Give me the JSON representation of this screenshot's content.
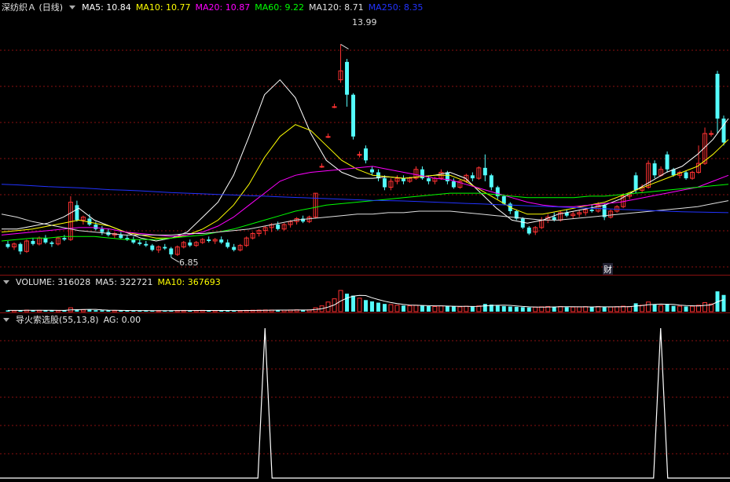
{
  "price_panel": {
    "title": "深纺织Ａ (日线)",
    "ma": [
      {
        "label": "MA5: 10.84",
        "color": "#ffffff"
      },
      {
        "label": "MA10: 10.77",
        "color": "#ffff00"
      },
      {
        "label": "MA20: 10.87",
        "color": "#ff00ff"
      },
      {
        "label": "MA60: 9.22",
        "color": "#00ff00"
      },
      {
        "label": "MA120: 8.71",
        "color": "#e0e0e0"
      },
      {
        "label": "MA250: 8.35",
        "color": "#2233ff"
      }
    ],
    "high_label": "13.99",
    "low_label": "6.85",
    "marker_label": "财"
  },
  "volume_panel": {
    "title": "VOLUME: 316028",
    "ma5": "MA5: 322721",
    "ma10": "MA10: 367693"
  },
  "indicator_panel": {
    "title": "导火索选股(55,13,8)",
    "value": "AG: 0.00"
  },
  "colors": {
    "up": "#ff3232",
    "down": "#54fcfc",
    "grid": "#8a1010",
    "ag": "#ffffff"
  },
  "chart_data": [
    {
      "type": "candlestick",
      "ylim": [
        6.4,
        15
      ],
      "candles": [
        [
          7.3,
          7.4,
          7.15,
          7.2
        ],
        [
          7.2,
          7.35,
          7.1,
          7.3
        ],
        [
          7.3,
          7.35,
          6.95,
          7.05
        ],
        [
          7.05,
          7.45,
          7.0,
          7.4
        ],
        [
          7.4,
          7.5,
          7.25,
          7.3
        ],
        [
          7.3,
          7.55,
          7.25,
          7.5
        ],
        [
          7.5,
          7.6,
          7.3,
          7.35
        ],
        [
          7.35,
          7.4,
          7.2,
          7.3
        ],
        [
          7.3,
          7.55,
          7.25,
          7.5
        ],
        [
          7.5,
          7.6,
          7.4,
          7.45
        ],
        [
          7.45,
          8.9,
          7.4,
          8.7
        ],
        [
          8.6,
          8.75,
          8.05,
          8.1
        ],
        [
          8.1,
          8.25,
          7.95,
          8.2
        ],
        [
          8.15,
          8.3,
          7.9,
          7.95
        ],
        [
          7.95,
          8.05,
          7.75,
          7.8
        ],
        [
          7.8,
          7.9,
          7.6,
          7.7
        ],
        [
          7.7,
          7.8,
          7.55,
          7.6
        ],
        [
          7.6,
          7.7,
          7.5,
          7.65
        ],
        [
          7.6,
          7.7,
          7.45,
          7.5
        ],
        [
          7.5,
          7.6,
          7.4,
          7.45
        ],
        [
          7.45,
          7.55,
          7.3,
          7.35
        ],
        [
          7.35,
          7.45,
          7.25,
          7.3
        ],
        [
          7.3,
          7.4,
          7.2,
          7.25
        ],
        [
          7.25,
          7.3,
          7.05,
          7.1
        ],
        [
          7.1,
          7.25,
          7.0,
          7.2
        ],
        [
          7.2,
          7.3,
          7.1,
          7.15
        ],
        [
          7.15,
          7.2,
          6.85,
          6.95
        ],
        [
          6.95,
          7.25,
          6.9,
          7.2
        ],
        [
          7.2,
          7.4,
          7.15,
          7.35
        ],
        [
          7.35,
          7.45,
          7.2,
          7.25
        ],
        [
          7.25,
          7.4,
          7.2,
          7.35
        ],
        [
          7.35,
          7.5,
          7.3,
          7.45
        ],
        [
          7.45,
          7.55,
          7.35,
          7.4
        ],
        [
          7.4,
          7.5,
          7.3,
          7.45
        ],
        [
          7.45,
          7.55,
          7.3,
          7.35
        ],
        [
          7.35,
          7.45,
          7.15,
          7.2
        ],
        [
          7.2,
          7.3,
          7.05,
          7.1
        ],
        [
          7.1,
          7.3,
          7.05,
          7.25
        ],
        [
          7.25,
          7.55,
          7.2,
          7.5
        ],
        [
          7.5,
          7.7,
          7.45,
          7.65
        ],
        [
          7.65,
          7.8,
          7.55,
          7.75
        ],
        [
          7.75,
          7.9,
          7.6,
          7.85
        ],
        [
          7.85,
          8.0,
          7.7,
          7.95
        ],
        [
          7.95,
          8.05,
          7.75,
          7.8
        ],
        [
          7.8,
          8.0,
          7.75,
          7.95
        ],
        [
          7.95,
          8.1,
          7.85,
          8.05
        ],
        [
          8.05,
          8.2,
          7.95,
          8.15
        ],
        [
          8.15,
          8.25,
          8.0,
          8.05
        ],
        [
          8.05,
          8.25,
          8.0,
          8.2
        ],
        [
          8.2,
          9.0,
          8.15,
          9.0
        ],
        [
          9.9,
          10.0,
          9.85,
          9.9
        ],
        [
          10.9,
          11.0,
          10.85,
          10.9
        ],
        [
          11.9,
          12.0,
          11.85,
          11.9
        ],
        [
          12.8,
          13.99,
          12.7,
          13.1
        ],
        [
          13.4,
          13.5,
          11.9,
          12.3
        ],
        [
          12.3,
          12.35,
          10.8,
          10.9
        ],
        [
          10.3,
          10.4,
          10.2,
          10.3
        ],
        [
          10.5,
          10.6,
          10.0,
          10.1
        ],
        [
          9.8,
          9.9,
          9.6,
          9.7
        ],
        [
          9.7,
          9.8,
          9.4,
          9.5
        ],
        [
          9.5,
          9.6,
          9.1,
          9.2
        ],
        [
          9.2,
          9.5,
          9.1,
          9.4
        ],
        [
          9.4,
          9.6,
          9.3,
          9.5
        ],
        [
          9.5,
          9.6,
          9.3,
          9.4
        ],
        [
          9.4,
          9.55,
          9.35,
          9.5
        ],
        [
          9.5,
          9.9,
          9.45,
          9.8
        ],
        [
          9.8,
          9.9,
          9.45,
          9.5
        ],
        [
          9.5,
          9.6,
          9.3,
          9.4
        ],
        [
          9.4,
          9.55,
          9.3,
          9.5
        ],
        [
          9.5,
          9.8,
          9.45,
          9.7
        ],
        [
          9.7,
          9.75,
          9.3,
          9.4
        ],
        [
          9.4,
          9.5,
          9.15,
          9.2
        ],
        [
          9.2,
          9.45,
          9.15,
          9.4
        ],
        [
          9.4,
          9.65,
          9.35,
          9.6
        ],
        [
          9.6,
          9.7,
          9.4,
          9.5
        ],
        [
          9.5,
          9.9,
          9.45,
          9.85
        ],
        [
          9.85,
          10.3,
          9.4,
          9.6
        ],
        [
          9.6,
          9.65,
          9.1,
          9.2
        ],
        [
          9.2,
          9.25,
          8.8,
          8.9
        ],
        [
          8.9,
          8.95,
          8.6,
          8.65
        ],
        [
          8.65,
          8.7,
          8.3,
          8.4
        ],
        [
          8.4,
          8.45,
          8.1,
          8.15
        ],
        [
          8.15,
          8.2,
          7.8,
          7.85
        ],
        [
          7.85,
          7.9,
          7.6,
          7.65
        ],
        [
          7.7,
          7.9,
          7.6,
          7.85
        ],
        [
          7.85,
          8.2,
          7.8,
          8.1
        ],
        [
          8.1,
          8.3,
          8.0,
          8.2
        ],
        [
          8.2,
          8.35,
          8.05,
          8.1
        ],
        [
          8.1,
          8.4,
          8.05,
          8.35
        ],
        [
          8.35,
          8.45,
          8.2,
          8.25
        ],
        [
          8.25,
          8.4,
          8.15,
          8.3
        ],
        [
          8.3,
          8.45,
          8.2,
          8.35
        ],
        [
          8.35,
          8.5,
          8.25,
          8.45
        ],
        [
          8.45,
          8.6,
          8.35,
          8.4
        ],
        [
          8.4,
          8.7,
          8.35,
          8.6
        ],
        [
          8.6,
          8.65,
          8.1,
          8.2
        ],
        [
          8.2,
          8.45,
          8.15,
          8.4
        ],
        [
          8.4,
          8.6,
          8.35,
          8.55
        ],
        [
          8.55,
          9.0,
          8.5,
          8.9
        ],
        [
          8.9,
          9.0,
          8.8,
          8.95
        ],
        [
          9.6,
          9.7,
          9.0,
          9.1
        ],
        [
          9.1,
          9.3,
          9.0,
          9.2
        ],
        [
          9.2,
          10.1,
          9.15,
          10.0
        ],
        [
          10.0,
          10.1,
          9.5,
          9.6
        ],
        [
          9.6,
          9.9,
          9.55,
          9.8
        ],
        [
          10.3,
          10.4,
          9.7,
          9.8
        ],
        [
          9.8,
          9.85,
          9.55,
          9.6
        ],
        [
          9.6,
          9.75,
          9.5,
          9.7
        ],
        [
          9.7,
          9.75,
          9.45,
          9.5
        ],
        [
          9.5,
          9.75,
          9.45,
          9.7
        ],
        [
          9.7,
          10.6,
          9.65,
          10.0
        ],
        [
          10.0,
          11.2,
          9.95,
          11.0
        ],
        [
          11.0,
          11.1,
          10.9,
          11.0
        ],
        [
          13.0,
          13.1,
          11.0,
          11.5
        ],
        [
          11.5,
          11.6,
          10.6,
          10.7
        ]
      ],
      "ma": {
        "MA5": [
          7.8,
          7.8,
          7.9,
          8.0,
          8.2,
          8.5,
          8.1,
          7.9,
          7.7,
          7.5,
          7.4,
          7.5,
          7.7,
          8.2,
          8.7,
          9.6,
          10.9,
          12.3,
          12.8,
          12.2,
          11.0,
          10.1,
          9.7,
          9.5,
          9.5,
          9.55,
          9.5,
          9.55,
          9.6,
          9.7,
          9.5,
          9.0,
          8.5,
          8.1,
          8.0,
          8.1,
          8.3,
          8.4,
          8.5,
          8.6,
          8.8,
          9.1,
          9.4,
          9.7,
          9.9,
          10.3,
          10.8,
          11.5
        ],
        "MA10": [
          7.7,
          7.75,
          7.8,
          7.9,
          8.0,
          8.1,
          8.0,
          7.9,
          7.7,
          7.6,
          7.5,
          7.5,
          7.6,
          7.8,
          8.1,
          8.6,
          9.3,
          10.2,
          10.9,
          11.3,
          11.1,
          10.6,
          10.1,
          9.8,
          9.6,
          9.55,
          9.5,
          9.55,
          9.6,
          9.6,
          9.4,
          9.1,
          8.8,
          8.5,
          8.3,
          8.3,
          8.4,
          8.5,
          8.6,
          8.7,
          8.9,
          9.1,
          9.3,
          9.5,
          9.7,
          9.9,
          10.3,
          10.8
        ],
        "MA20": [
          7.6,
          7.65,
          7.7,
          7.75,
          7.8,
          7.85,
          7.85,
          7.8,
          7.7,
          7.65,
          7.6,
          7.55,
          7.6,
          7.7,
          7.9,
          8.2,
          8.6,
          9.0,
          9.4,
          9.6,
          9.7,
          9.75,
          9.8,
          9.85,
          9.9,
          9.8,
          9.7,
          9.6,
          9.5,
          9.45,
          9.3,
          9.15,
          9.0,
          8.85,
          8.7,
          8.6,
          8.55,
          8.55,
          8.6,
          8.65,
          8.7,
          8.8,
          8.9,
          9.0,
          9.1,
          9.2,
          9.4,
          9.6
        ],
        "MA60": [
          7.4,
          7.45,
          7.5,
          7.5,
          7.55,
          7.55,
          7.55,
          7.5,
          7.45,
          7.45,
          7.45,
          7.5,
          7.55,
          7.6,
          7.7,
          7.8,
          7.95,
          8.1,
          8.25,
          8.4,
          8.5,
          8.6,
          8.65,
          8.7,
          8.75,
          8.8,
          8.85,
          8.9,
          8.95,
          9.0,
          9.0,
          9.0,
          8.95,
          8.9,
          8.85,
          8.85,
          8.85,
          8.85,
          8.9,
          8.9,
          8.95,
          9.0,
          9.05,
          9.1,
          9.15,
          9.2,
          9.25,
          9.3
        ],
        "MA120": [
          8.3,
          8.2,
          8.05,
          7.95,
          7.85,
          7.75,
          7.7,
          7.65,
          7.6,
          7.6,
          7.6,
          7.6,
          7.65,
          7.65,
          7.7,
          7.75,
          7.8,
          7.9,
          8.0,
          8.1,
          8.15,
          8.2,
          8.25,
          8.3,
          8.3,
          8.35,
          8.35,
          8.4,
          8.4,
          8.4,
          8.35,
          8.3,
          8.25,
          8.2,
          8.15,
          8.1,
          8.1,
          8.15,
          8.2,
          8.25,
          8.3,
          8.35,
          8.4,
          8.45,
          8.5,
          8.55,
          8.65,
          8.75
        ],
        "MA250": [
          9.3,
          9.28,
          9.25,
          9.22,
          9.2,
          9.18,
          9.15,
          9.12,
          9.1,
          9.08,
          9.05,
          9.02,
          9.0,
          8.98,
          8.96,
          8.94,
          8.92,
          8.9,
          8.88,
          8.86,
          8.84,
          8.82,
          8.8,
          8.78,
          8.76,
          8.75,
          8.74,
          8.72,
          8.7,
          8.68,
          8.66,
          8.64,
          8.62,
          8.6,
          8.58,
          8.56,
          8.54,
          8.52,
          8.5,
          8.48,
          8.46,
          8.44,
          8.42,
          8.4,
          8.38,
          8.37,
          8.36,
          8.35
        ]
      }
    },
    {
      "type": "bar",
      "name": "VOLUME",
      "values": [
        20,
        18,
        22,
        24,
        19,
        20,
        21,
        18,
        19,
        22,
        60,
        35,
        28,
        30,
        22,
        20,
        18,
        19,
        17,
        18,
        16,
        15,
        17,
        16,
        15,
        14,
        20,
        18,
        19,
        17,
        18,
        20,
        18,
        17,
        19,
        18,
        16,
        17,
        20,
        22,
        24,
        26,
        25,
        23,
        24,
        26,
        28,
        25,
        27,
        60,
        90,
        150,
        200,
        330,
        280,
        250,
        210,
        180,
        160,
        140,
        120,
        110,
        100,
        95,
        90,
        100,
        95,
        85,
        80,
        90,
        85,
        80,
        75,
        85,
        80,
        90,
        120,
        110,
        95,
        85,
        80,
        75,
        70,
        65,
        70,
        75,
        80,
        75,
        80,
        70,
        72,
        75,
        78,
        72,
        80,
        70,
        72,
        78,
        85,
        80,
        130,
        100,
        150,
        110,
        95,
        120,
        90,
        85,
        80,
        85,
        100,
        140,
        120,
        316,
        260
      ]
    },
    {
      "type": "line",
      "name": "AG",
      "values": [
        0,
        0,
        0,
        0,
        0,
        0,
        0,
        0,
        0,
        0,
        0,
        0,
        0,
        0,
        0,
        0,
        0,
        0,
        0,
        0,
        0,
        0,
        0,
        0,
        0,
        0,
        0,
        0,
        0,
        0,
        0,
        0,
        0,
        0,
        0,
        0,
        0,
        0,
        0,
        0,
        0,
        0,
        0,
        0,
        0,
        0,
        0,
        0,
        0,
        0,
        0,
        0,
        0,
        0,
        0,
        0,
        0,
        0,
        0,
        0,
        0,
        0,
        0,
        0,
        0,
        0,
        0,
        0,
        0,
        0,
        0,
        0,
        0,
        0,
        0,
        0,
        0,
        0,
        0,
        0,
        0,
        0,
        0,
        0,
        0,
        0,
        0,
        0,
        0,
        0,
        0,
        0,
        0,
        0,
        0,
        0,
        0,
        0,
        0,
        0,
        0,
        0,
        0,
        0,
        0,
        0,
        0,
        0,
        0,
        0,
        0,
        0,
        0,
        0,
        0
      ],
      "spikes": [
        0.363,
        0.905
      ],
      "ylim": [
        0,
        1
      ]
    }
  ]
}
